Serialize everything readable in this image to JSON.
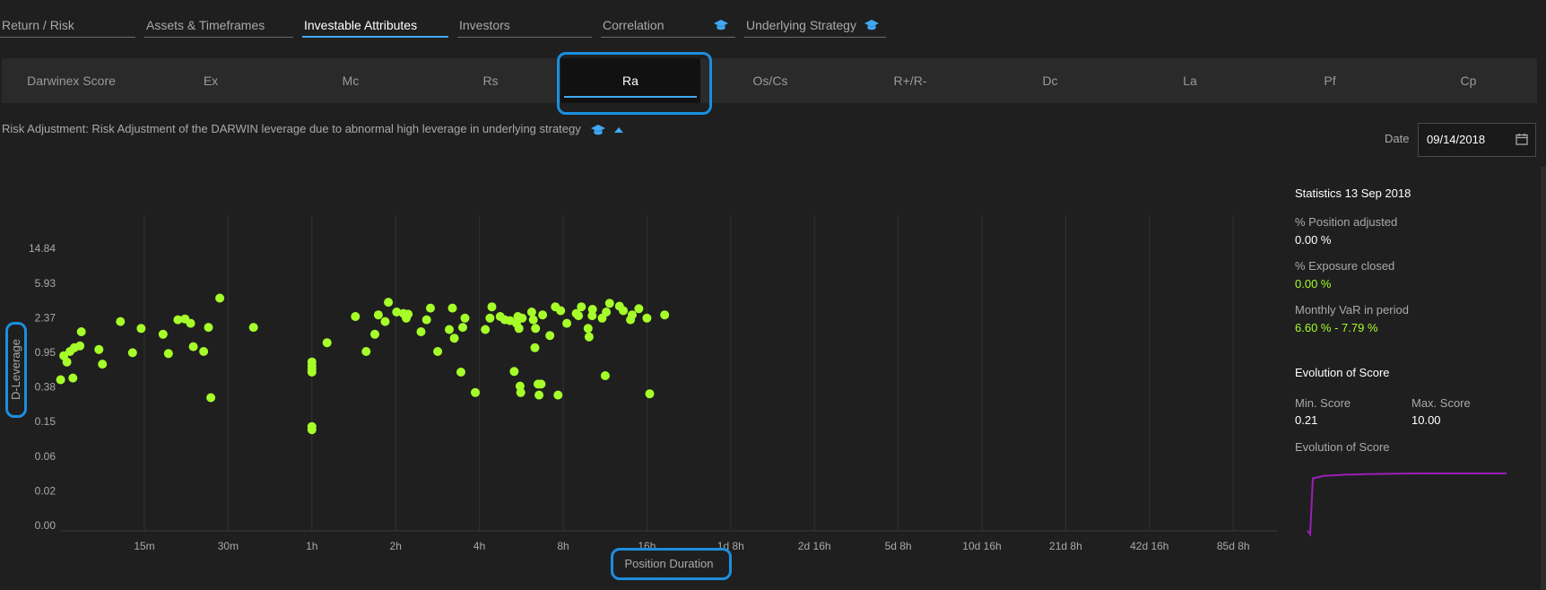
{
  "top_tabs": [
    {
      "label": "Return / Risk",
      "active": false,
      "icon": ""
    },
    {
      "label": "Assets & Timeframes",
      "active": false,
      "icon": ""
    },
    {
      "label": "Investable Attributes",
      "active": true,
      "icon": ""
    },
    {
      "label": "Investors",
      "active": false,
      "icon": ""
    },
    {
      "label": "Correlation",
      "active": false,
      "icon": "graduation-cap-icon"
    },
    {
      "label": "Underlying Strategy",
      "active": false,
      "icon": "graduation-cap-icon"
    }
  ],
  "attribute_tabs": [
    {
      "label": "Darwinex Score",
      "active": false
    },
    {
      "label": "Ex",
      "active": false
    },
    {
      "label": "Mc",
      "active": false
    },
    {
      "label": "Rs",
      "active": false
    },
    {
      "label": "Ra",
      "active": true
    },
    {
      "label": "Os/Cs",
      "active": false
    },
    {
      "label": "R+/R-",
      "active": false
    },
    {
      "label": "Dc",
      "active": false
    },
    {
      "label": "La",
      "active": false
    },
    {
      "label": "Pf",
      "active": false
    },
    {
      "label": "Cp",
      "active": false
    }
  ],
  "description": "Risk Adjustment: Risk Adjustment of the DARWIN leverage due to abnormal high leverage in underlying strategy",
  "date": {
    "label": "Date",
    "value": "09/14/2018"
  },
  "colors": {
    "accent": "#3fa9f5",
    "highlight": "#1a8fe0",
    "points": "#a6ff29",
    "score_line": "#9b1fb5"
  },
  "stats": {
    "title": "Statistics 13 Sep 2018",
    "position_adjusted_label": "% Position adjusted",
    "position_adjusted_value": "0.00 %",
    "exposure_closed_label": "% Exposure closed",
    "exposure_closed_value": "0.00 %",
    "var_label": "Monthly VaR in period",
    "var_value": "6.60 % - 7.79 %",
    "evolution_title": "Evolution of Score",
    "min_label": "Min. Score",
    "min_value": "0.21",
    "max_label": "Max. Score",
    "max_value": "10.00",
    "evolution_chart_label": "Evolution of Score",
    "score_series": [
      0.9,
      0.3,
      9.2,
      9.6,
      9.7,
      9.8,
      9.85,
      9.9,
      9.92,
      9.95,
      9.97,
      9.98,
      10.0,
      10.0,
      10.0,
      10.0,
      10.0,
      10.0,
      10.0,
      10.0,
      10.0
    ]
  },
  "chart_data": {
    "type": "scatter",
    "xlabel": "Position Duration",
    "ylabel": "D-Leverage",
    "x_scale": "log2 minutes",
    "x_ticks": [
      "15m",
      "30m",
      "1h",
      "2h",
      "4h",
      "8h",
      "16h",
      "1d 8h",
      "2d 16h",
      "5d 8h",
      "10d 16h",
      "21d 8h",
      "42d 16h",
      "85d 8h"
    ],
    "y_ticks": [
      "0.00",
      "0.02",
      "0.06",
      "0.15",
      "0.38",
      "0.95",
      "2.37",
      "5.93",
      "14.84"
    ],
    "grid": true,
    "points": [
      {
        "x": 7.5,
        "y": 0.45
      },
      {
        "x": 7.7,
        "y": 0.85
      },
      {
        "x": 7.9,
        "y": 0.72
      },
      {
        "x": 8.1,
        "y": 0.95
      },
      {
        "x": 8.4,
        "y": 1.05
      },
      {
        "x": 8.3,
        "y": 0.47
      },
      {
        "x": 8.8,
        "y": 1.1
      },
      {
        "x": 8.9,
        "y": 1.6
      },
      {
        "x": 10.3,
        "y": 1.0
      },
      {
        "x": 10.6,
        "y": 0.68
      },
      {
        "x": 12.3,
        "y": 2.1
      },
      {
        "x": 13.6,
        "y": 0.92
      },
      {
        "x": 14.6,
        "y": 1.75
      },
      {
        "x": 17.5,
        "y": 1.5
      },
      {
        "x": 18.3,
        "y": 0.9
      },
      {
        "x": 19.8,
        "y": 2.2
      },
      {
        "x": 21.0,
        "y": 2.25
      },
      {
        "x": 22.0,
        "y": 2.0
      },
      {
        "x": 22.5,
        "y": 1.08
      },
      {
        "x": 24.5,
        "y": 0.95
      },
      {
        "x": 25.5,
        "y": 1.8
      },
      {
        "x": 26.0,
        "y": 0.28
      },
      {
        "x": 28.0,
        "y": 3.9
      },
      {
        "x": 37.0,
        "y": 1.8
      },
      {
        "x": 60.0,
        "y": 0.55
      },
      {
        "x": 60.0,
        "y": 0.6
      },
      {
        "x": 60.0,
        "y": 0.65
      },
      {
        "x": 60.0,
        "y": 0.72
      },
      {
        "x": 60.0,
        "y": 0.12
      },
      {
        "x": 60.0,
        "y": 0.13
      },
      {
        "x": 68.0,
        "y": 1.2
      },
      {
        "x": 86.0,
        "y": 2.4
      },
      {
        "x": 94.0,
        "y": 0.95
      },
      {
        "x": 101.0,
        "y": 1.5
      },
      {
        "x": 104.0,
        "y": 2.5
      },
      {
        "x": 110.0,
        "y": 2.1
      },
      {
        "x": 113.0,
        "y": 3.5
      },
      {
        "x": 121.0,
        "y": 2.7
      },
      {
        "x": 128.0,
        "y": 2.6
      },
      {
        "x": 131.0,
        "y": 2.3
      },
      {
        "x": 133.0,
        "y": 2.55
      },
      {
        "x": 148.0,
        "y": 1.6
      },
      {
        "x": 155.0,
        "y": 2.2
      },
      {
        "x": 160.0,
        "y": 3.0
      },
      {
        "x": 170.0,
        "y": 0.95
      },
      {
        "x": 187.0,
        "y": 1.7
      },
      {
        "x": 192.0,
        "y": 3.0
      },
      {
        "x": 195.0,
        "y": 1.35
      },
      {
        "x": 206.0,
        "y": 0.55
      },
      {
        "x": 209.0,
        "y": 1.8
      },
      {
        "x": 213.0,
        "y": 2.3
      },
      {
        "x": 232.0,
        "y": 0.32
      },
      {
        "x": 252.0,
        "y": 1.7
      },
      {
        "x": 262.0,
        "y": 2.3
      },
      {
        "x": 266.0,
        "y": 3.1
      },
      {
        "x": 285.0,
        "y": 2.4
      },
      {
        "x": 296.0,
        "y": 2.2
      },
      {
        "x": 309.0,
        "y": 2.15
      },
      {
        "x": 320.0,
        "y": 0.56
      },
      {
        "x": 326.0,
        "y": 2.0
      },
      {
        "x": 330.0,
        "y": 2.4
      },
      {
        "x": 333.0,
        "y": 1.75
      },
      {
        "x": 336.0,
        "y": 0.38
      },
      {
        "x": 338.0,
        "y": 0.32
      },
      {
        "x": 342.0,
        "y": 2.3
      },
      {
        "x": 370.0,
        "y": 2.7
      },
      {
        "x": 375.0,
        "y": 2.2
      },
      {
        "x": 380.0,
        "y": 1.05
      },
      {
        "x": 382.0,
        "y": 1.75
      },
      {
        "x": 390.0,
        "y": 0.4
      },
      {
        "x": 393.0,
        "y": 0.3
      },
      {
        "x": 400.0,
        "y": 0.4
      },
      {
        "x": 405.0,
        "y": 2.5
      },
      {
        "x": 430.0,
        "y": 1.45
      },
      {
        "x": 450.0,
        "y": 3.1
      },
      {
        "x": 460.0,
        "y": 0.3
      },
      {
        "x": 470.0,
        "y": 2.8
      },
      {
        "x": 495.0,
        "y": 2.0
      },
      {
        "x": 535.0,
        "y": 2.6
      },
      {
        "x": 545.0,
        "y": 2.45
      },
      {
        "x": 558.0,
        "y": 3.1
      },
      {
        "x": 590.0,
        "y": 1.75
      },
      {
        "x": 595.0,
        "y": 1.4
      },
      {
        "x": 610.0,
        "y": 2.45
      },
      {
        "x": 612.0,
        "y": 2.9
      },
      {
        "x": 663.0,
        "y": 2.3
      },
      {
        "x": 680.0,
        "y": 0.5
      },
      {
        "x": 686.0,
        "y": 2.7
      },
      {
        "x": 705.0,
        "y": 3.4
      },
      {
        "x": 765.0,
        "y": 3.15
      },
      {
        "x": 790.0,
        "y": 2.8
      },
      {
        "x": 838.0,
        "y": 2.2
      },
      {
        "x": 850.0,
        "y": 2.5
      },
      {
        "x": 898.0,
        "y": 2.95
      },
      {
        "x": 960.0,
        "y": 2.3
      },
      {
        "x": 982.0,
        "y": 0.31
      },
      {
        "x": 1112.0,
        "y": 2.5
      }
    ]
  }
}
